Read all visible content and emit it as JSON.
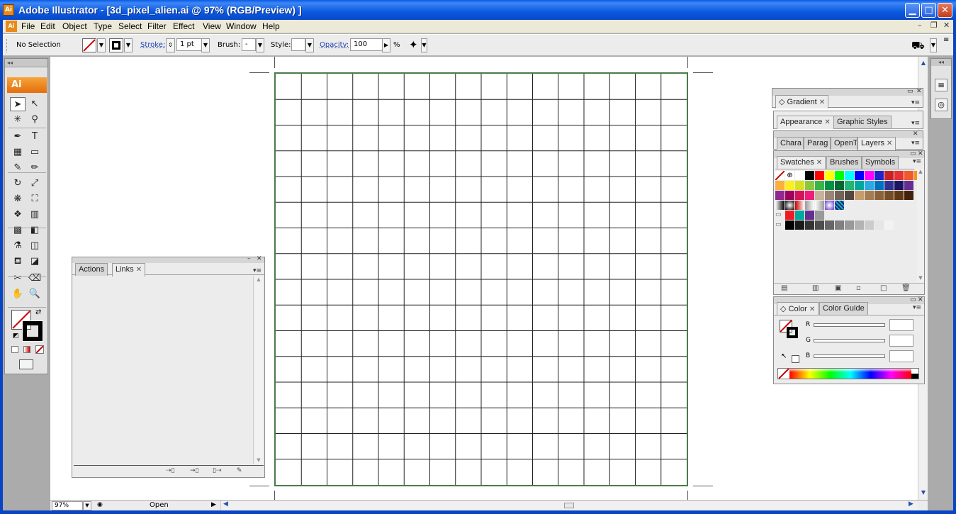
{
  "window": {
    "app_icon": "Ai",
    "title": "Adobe Illustrator - [3d_pixel_alien.ai @ 97% (RGB/Preview) ]",
    "minimize": "▁",
    "maximize": "□",
    "close": "✕"
  },
  "menubar": {
    "doc_icon": "Ai",
    "items": [
      "File",
      "Edit",
      "Object",
      "Type",
      "Select",
      "Filter",
      "Effect",
      "View",
      "Window",
      "Help"
    ],
    "mdi_min": "–",
    "mdi_restore": "❐",
    "mdi_close": "✕"
  },
  "control": {
    "selection": "No Selection",
    "stroke_label": "Stroke:",
    "stroke_value": "1 pt",
    "brush_label": "Brush:",
    "brush_value": "-",
    "style_label": "Style:",
    "opacity_label": "Opacity:",
    "opacity_value": "100",
    "percent": "%"
  },
  "toolbox": {
    "logo": "Ai",
    "collapse": "◂◂",
    "tools": [
      {
        "name": "selection-tool",
        "glyph": "➤"
      },
      {
        "name": "direct-selection-tool",
        "glyph": "↖"
      },
      {
        "name": "magic-wand-tool",
        "glyph": "✳"
      },
      {
        "name": "lasso-tool",
        "glyph": "⚲"
      },
      {
        "name": "pen-tool",
        "glyph": "✒"
      },
      {
        "name": "type-tool",
        "glyph": "T"
      },
      {
        "name": "line-tool",
        "glyph": "▦"
      },
      {
        "name": "rectangle-tool",
        "glyph": "▭"
      },
      {
        "name": "paintbrush-tool",
        "glyph": "✎"
      },
      {
        "name": "pencil-tool",
        "glyph": "✏"
      },
      {
        "name": "rotate-tool",
        "glyph": "↻"
      },
      {
        "name": "scale-tool",
        "glyph": "⤢"
      },
      {
        "name": "warp-tool",
        "glyph": "❋"
      },
      {
        "name": "free-transform-tool",
        "glyph": "⛶"
      },
      {
        "name": "symbol-sprayer-tool",
        "glyph": "❖"
      },
      {
        "name": "graph-tool",
        "glyph": "▥"
      },
      {
        "name": "mesh-tool",
        "glyph": "▩"
      },
      {
        "name": "gradient-tool",
        "glyph": "◧"
      },
      {
        "name": "eyedropper-tool",
        "glyph": "⚗"
      },
      {
        "name": "blend-tool",
        "glyph": "◫"
      },
      {
        "name": "live-paint-bucket-tool",
        "glyph": "⛾"
      },
      {
        "name": "live-paint-selection-tool",
        "glyph": "◪"
      },
      {
        "name": "slice-tool",
        "glyph": "✂"
      },
      {
        "name": "eraser-tool",
        "glyph": "⌫"
      },
      {
        "name": "hand-tool",
        "glyph": "✋"
      },
      {
        "name": "zoom-tool",
        "glyph": "🔍"
      }
    ]
  },
  "panels": {
    "gradient": {
      "tab": "Gradient"
    },
    "appearance": {
      "tabs": [
        "Appearance",
        "Graphic Styles"
      ]
    },
    "character": {
      "tabs": [
        "Chara",
        "Parag",
        "OpenT",
        "Layers"
      ]
    },
    "swatches": {
      "tabs": [
        "Swatches",
        "Brushes",
        "Symbols"
      ]
    },
    "color": {
      "tabs": [
        "Color",
        "Color Guide"
      ],
      "channels": [
        "R",
        "G",
        "B"
      ]
    },
    "links": {
      "tabs": [
        "Actions",
        "Links"
      ]
    }
  },
  "swatch_colors": {
    "row1": [
      "#ffffff",
      "#000000",
      "#ff0000",
      "#ffff00",
      "#00ff00",
      "#00ffff",
      "#0000ff",
      "#ff00ff",
      "#2323c8",
      "#c82323",
      "#e63232",
      "#f05a28",
      "#f7931e"
    ],
    "row2": [
      "#fbb03b",
      "#fcee21",
      "#d9e021",
      "#8cc63f",
      "#39b54a",
      "#009245",
      "#006837",
      "#22b573",
      "#00a99d",
      "#29abe2",
      "#0071bc",
      "#2e3192",
      "#1b1464",
      "#662d91"
    ],
    "row3": [
      "#93278f",
      "#9e005d",
      "#d4145a",
      "#ed1e79",
      "#c7b299",
      "#998675",
      "#736357",
      "#534741",
      "#c69c6d",
      "#a67c52",
      "#8c6239",
      "#754c24",
      "#603813",
      "#42210b"
    ],
    "row5": [
      "#ed1c24",
      "#00a99d",
      "#662d91",
      "#999999"
    ],
    "grays": [
      "#000000",
      "#1a1a1a",
      "#333333",
      "#4d4d4d",
      "#666666",
      "#808080",
      "#999999",
      "#b3b3b3",
      "#cccccc",
      "#e6e6e6",
      "#f2f2f2"
    ]
  },
  "status": {
    "zoom": "97%",
    "status_text": "Open"
  }
}
